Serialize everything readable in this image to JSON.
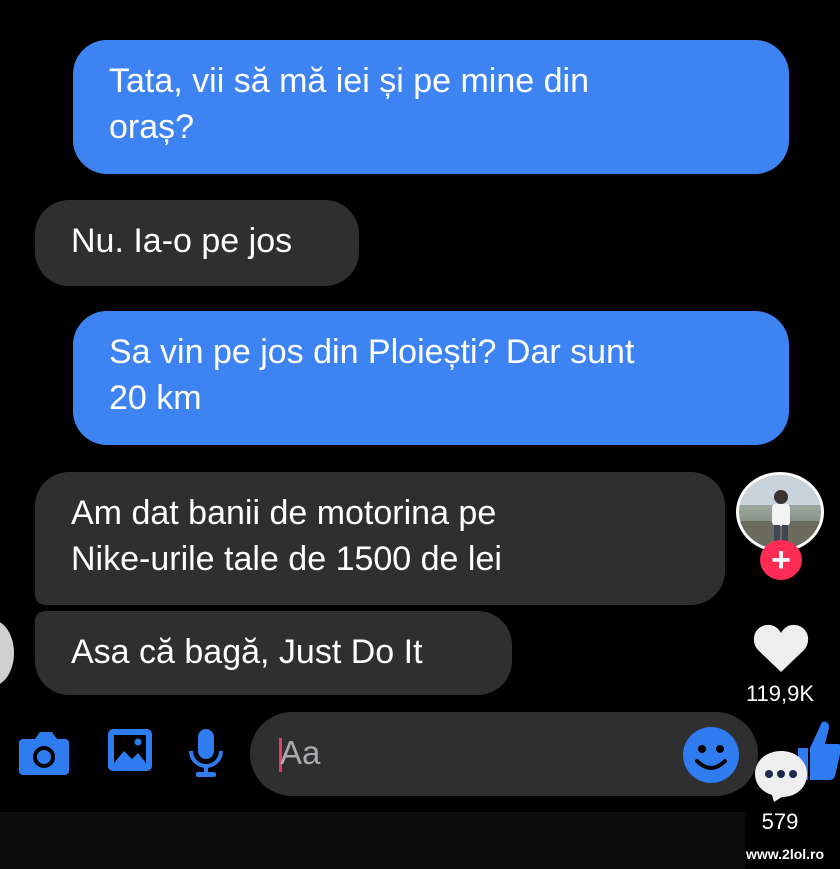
{
  "messages": [
    {
      "id": "b1",
      "side": "sent",
      "lines": [
        "Tata, vii să mă iei și pe mine din",
        "oraș?"
      ]
    },
    {
      "id": "b2",
      "side": "received",
      "lines": [
        "Nu. Ia-o pe jos"
      ]
    },
    {
      "id": "b3",
      "side": "sent",
      "lines": [
        "Sa vin pe jos din Ploiești? Dar sunt",
        "20 km"
      ]
    },
    {
      "id": "b4",
      "side": "received",
      "lines": [
        "Am dat banii de motorina pe",
        "Nike-urile tale de 1500 de lei"
      ]
    },
    {
      "id": "b5",
      "side": "received",
      "lines": [
        "Asa că bagă, Just Do It"
      ]
    }
  ],
  "composer": {
    "placeholder": "Aa",
    "icons": [
      "camera-icon",
      "gallery-icon",
      "microphone-icon",
      "emoji-icon",
      "thumbs-up-icon"
    ]
  },
  "tiktok": {
    "likes": "119,9K",
    "comments": "579",
    "follow_symbol": "+",
    "icons": [
      "heart-icon",
      "comment-icon"
    ]
  },
  "watermark": "www.2lol.ro",
  "colors": {
    "sent_bubble": "#3d84f2",
    "received_bubble": "#2f2f30",
    "accent_blue": "#2f7bf0",
    "follow_red": "#fe2c55"
  }
}
